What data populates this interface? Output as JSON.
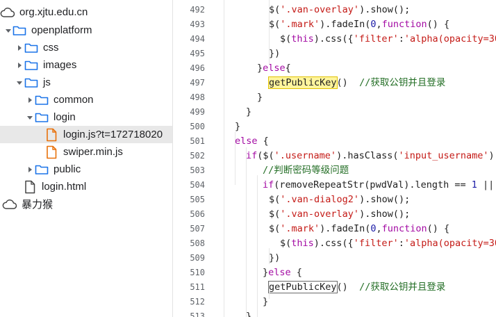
{
  "file_tree": {
    "items": [
      {
        "label": "org.xjtu.edu.cn",
        "kind": "cloud",
        "expanded": true,
        "has_arrow": false,
        "selected": false
      },
      {
        "label": "openplatform",
        "kind": "folder",
        "expanded": true,
        "has_arrow": true,
        "selected": false
      },
      {
        "label": "css",
        "kind": "folder",
        "expanded": false,
        "has_arrow": true,
        "selected": false
      },
      {
        "label": "images",
        "kind": "folder",
        "expanded": false,
        "has_arrow": true,
        "selected": false
      },
      {
        "label": "js",
        "kind": "folder",
        "expanded": true,
        "has_arrow": true,
        "selected": false
      },
      {
        "label": "common",
        "kind": "folder",
        "expanded": false,
        "has_arrow": true,
        "selected": false
      },
      {
        "label": "login",
        "kind": "folder",
        "expanded": true,
        "has_arrow": true,
        "selected": false
      },
      {
        "label": "login.js?t=172718020",
        "kind": "file-js",
        "expanded": false,
        "has_arrow": false,
        "selected": true
      },
      {
        "label": "swiper.min.js",
        "kind": "file-js",
        "expanded": false,
        "has_arrow": false,
        "selected": false
      },
      {
        "label": "public",
        "kind": "folder",
        "expanded": false,
        "has_arrow": true,
        "selected": false
      },
      {
        "label": "login.html",
        "kind": "file",
        "expanded": false,
        "has_arrow": false,
        "selected": false
      },
      {
        "label": "暴力猴",
        "kind": "cloud",
        "expanded": false,
        "has_arrow": false,
        "selected": false
      }
    ]
  },
  "editor": {
    "lines": [
      {
        "n": "492",
        "tokens": [
          [
            "p",
            "$("
          ],
          [
            "s",
            "'.van-overlay'"
          ],
          [
            "p",
            ").show();"
          ]
        ]
      },
      {
        "n": "493",
        "tokens": [
          [
            "p",
            "$("
          ],
          [
            "s",
            "'.mark'"
          ],
          [
            "p",
            ").fadeIn("
          ],
          [
            "num",
            "0"
          ],
          [
            "p",
            ","
          ],
          [
            "k",
            "function"
          ],
          [
            "p",
            "() {"
          ]
        ]
      },
      {
        "n": "494",
        "tokens": [
          [
            "p",
            "$("
          ],
          [
            "k",
            "this"
          ],
          [
            "p",
            ").css({"
          ],
          [
            "s",
            "'filter'"
          ],
          [
            "p",
            ":"
          ],
          [
            "s",
            "'alpha(opacity=30"
          ]
        ]
      },
      {
        "n": "495",
        "tokens": [
          [
            "p",
            "})"
          ]
        ]
      },
      {
        "n": "496",
        "tokens": [
          [
            "p",
            "}"
          ],
          [
            "k",
            "else"
          ],
          [
            "p",
            "{"
          ]
        ]
      },
      {
        "n": "497",
        "tokens": [
          [
            "hy",
            "getPublicKey"
          ],
          [
            "p",
            "()  "
          ],
          [
            "c",
            "//获取公钥并且登录"
          ]
        ]
      },
      {
        "n": "498",
        "tokens": [
          [
            "p",
            "}"
          ]
        ]
      },
      {
        "n": "499",
        "tokens": [
          [
            "p",
            "}"
          ]
        ]
      },
      {
        "n": "500",
        "tokens": [
          [
            "p",
            "}"
          ]
        ]
      },
      {
        "n": "501",
        "tokens": [
          [
            "k",
            "else"
          ],
          [
            "p",
            " {"
          ]
        ]
      },
      {
        "n": "502",
        "tokens": [
          [
            "k",
            "if"
          ],
          [
            "p",
            "($("
          ],
          [
            "s",
            "'.username'"
          ],
          [
            "p",
            ").hasClass("
          ],
          [
            "s",
            "'input_username'"
          ],
          [
            "p",
            ")"
          ]
        ]
      },
      {
        "n": "503",
        "tokens": [
          [
            "c",
            "//判断密码等级问题"
          ]
        ]
      },
      {
        "n": "504",
        "tokens": [
          [
            "k",
            "if"
          ],
          [
            "p",
            "(removeRepeatStr(pwdVal).length == "
          ],
          [
            "num",
            "1"
          ],
          [
            "p",
            " ||"
          ]
        ]
      },
      {
        "n": "505",
        "tokens": [
          [
            "p",
            "$("
          ],
          [
            "s",
            "'.van-dialog2'"
          ],
          [
            "p",
            ").show();"
          ]
        ]
      },
      {
        "n": "506",
        "tokens": [
          [
            "p",
            "$("
          ],
          [
            "s",
            "'.van-overlay'"
          ],
          [
            "p",
            ").show();"
          ]
        ]
      },
      {
        "n": "507",
        "tokens": [
          [
            "p",
            "$("
          ],
          [
            "s",
            "'.mark'"
          ],
          [
            "p",
            ").fadeIn("
          ],
          [
            "num",
            "0"
          ],
          [
            "p",
            ","
          ],
          [
            "k",
            "function"
          ],
          [
            "p",
            "() {"
          ]
        ]
      },
      {
        "n": "508",
        "tokens": [
          [
            "p",
            "$("
          ],
          [
            "k",
            "this"
          ],
          [
            "p",
            ").css({"
          ],
          [
            "s",
            "'filter'"
          ],
          [
            "p",
            ":"
          ],
          [
            "s",
            "'alpha(opacity=30"
          ]
        ]
      },
      {
        "n": "509",
        "tokens": [
          [
            "p",
            "})"
          ]
        ]
      },
      {
        "n": "510",
        "tokens": [
          [
            "p",
            "}"
          ],
          [
            "k",
            "else"
          ],
          [
            "p",
            " {"
          ]
        ]
      },
      {
        "n": "511",
        "tokens": [
          [
            "hb",
            "getPublicKey"
          ],
          [
            "p",
            "()  "
          ],
          [
            "c",
            "//获取公钥并且登录"
          ]
        ]
      },
      {
        "n": "512",
        "tokens": [
          [
            "p",
            "}"
          ]
        ]
      },
      {
        "n": "513",
        "tokens": [
          [
            "p",
            "}"
          ]
        ]
      }
    ]
  },
  "colors": {
    "string": "#c41a16",
    "keyword": "#a30aa3",
    "number": "#1a1aa6",
    "comment": "#236e25",
    "selected_row": "#e8e8e8",
    "folder_icon": "#1a73e8",
    "js_file_icon": "#e8710a"
  }
}
